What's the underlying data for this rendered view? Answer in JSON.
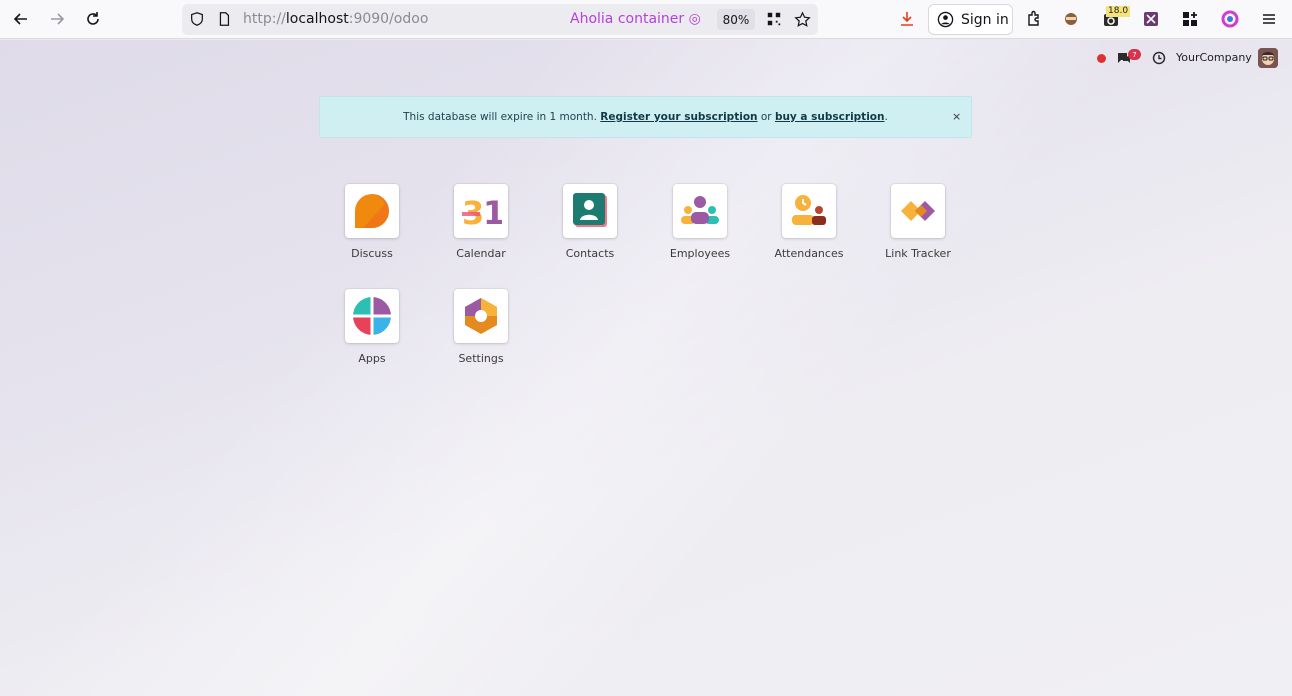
{
  "browser": {
    "url_prefix": "http://",
    "url_host": "localhost",
    "url_rest": ":9090/odoo",
    "container_label": "Aholia container",
    "zoom": "80%",
    "sign_in_label": "Sign in",
    "extension_badge": "18.0"
  },
  "systray": {
    "chat_count": "7",
    "company": "YourCompany"
  },
  "banner": {
    "text_before": "This database will expire in 1 month. ",
    "link_register": "Register your subscription",
    "text_middle": " or ",
    "link_buy": "buy a subscription",
    "text_after": ".",
    "close": "×"
  },
  "apps": [
    {
      "label": "Discuss",
      "icon": "discuss-icon"
    },
    {
      "label": "Calendar",
      "icon": "calendar-icon"
    },
    {
      "label": "Contacts",
      "icon": "contacts-icon"
    },
    {
      "label": "Employees",
      "icon": "employees-icon"
    },
    {
      "label": "Attendances",
      "icon": "attendances-icon"
    },
    {
      "label": "Link Tracker",
      "icon": "link-tracker-icon"
    },
    {
      "label": "Apps",
      "icon": "apps-icon"
    },
    {
      "label": "Settings",
      "icon": "settings-icon"
    }
  ],
  "colors": {
    "accent_container": "#b441dc",
    "banner_bg": "#cfeff3",
    "notification": "#e03131"
  }
}
